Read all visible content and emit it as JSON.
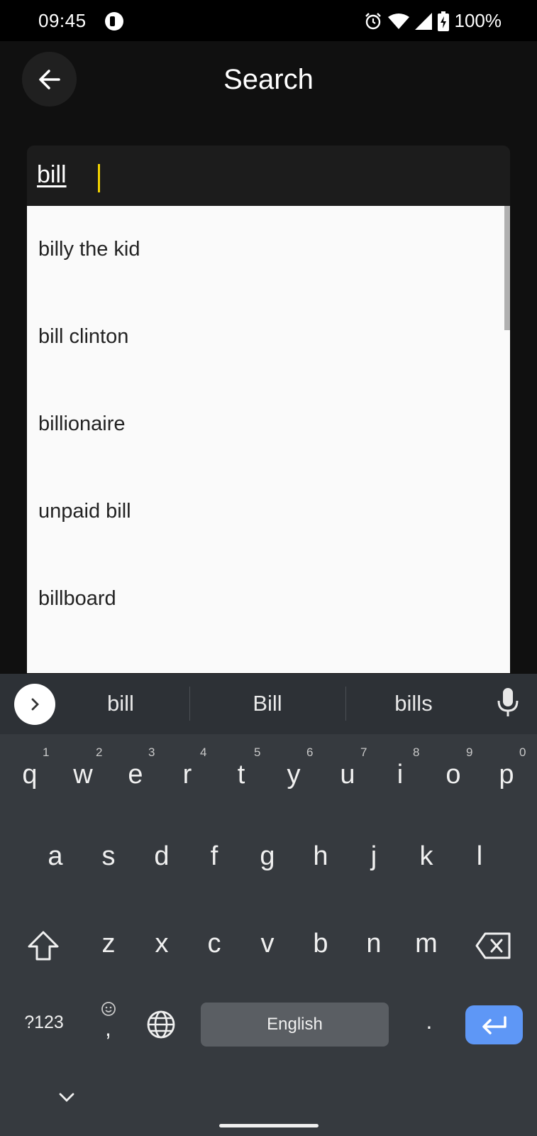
{
  "status_bar": {
    "time": "09:45",
    "battery": "100%"
  },
  "header": {
    "title": "Search",
    "back_icon": "arrow-left-icon"
  },
  "search": {
    "query": "bill"
  },
  "suggestions": [
    "billy the kid",
    "bill clinton",
    "billionaire",
    "unpaid bill",
    "billboard"
  ],
  "keyboard": {
    "word_suggestions": [
      "bill",
      "Bill",
      "bills"
    ],
    "row1": [
      {
        "letter": "q",
        "num": "1"
      },
      {
        "letter": "w",
        "num": "2"
      },
      {
        "letter": "e",
        "num": "3"
      },
      {
        "letter": "r",
        "num": "4"
      },
      {
        "letter": "t",
        "num": "5"
      },
      {
        "letter": "y",
        "num": "6"
      },
      {
        "letter": "u",
        "num": "7"
      },
      {
        "letter": "i",
        "num": "8"
      },
      {
        "letter": "o",
        "num": "9"
      },
      {
        "letter": "p",
        "num": "0"
      }
    ],
    "row2": [
      "a",
      "s",
      "d",
      "f",
      "g",
      "h",
      "j",
      "k",
      "l"
    ],
    "row3": [
      "z",
      "x",
      "c",
      "v",
      "b",
      "n",
      "m"
    ],
    "symbols_label": "?123",
    "comma": ",",
    "space_label": "English",
    "period": "."
  },
  "colors": {
    "accent": "#5e97f6",
    "cursor": "#f2d200",
    "keyboard_bg": "#363a3f"
  }
}
